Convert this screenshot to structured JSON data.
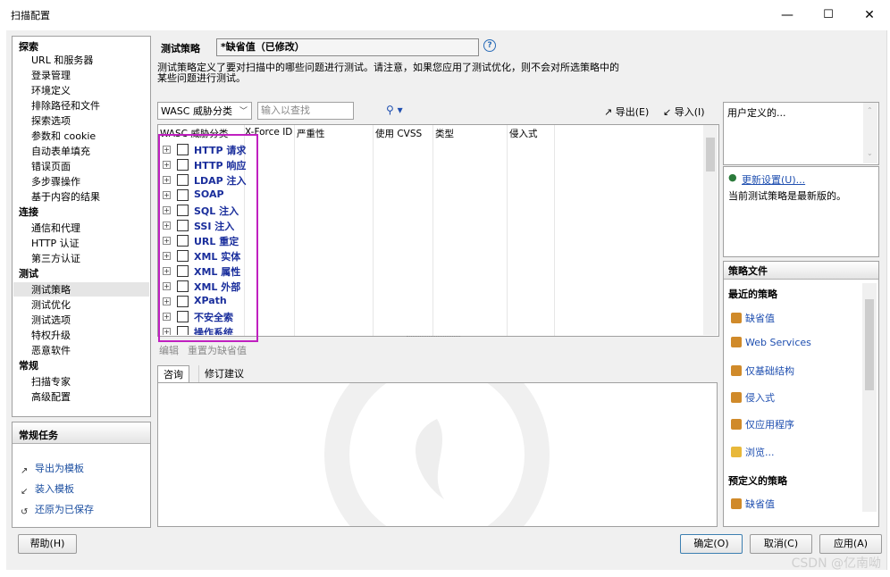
{
  "window": {
    "title": "扫描配置",
    "min_glyph": "—",
    "max_glyph": "☐",
    "close_glyph": "✕"
  },
  "nav": {
    "groups": [
      {
        "label": "探索",
        "items": [
          "URL 和服务器",
          "登录管理",
          "环境定义",
          "排除路径和文件",
          "探索选项",
          "参数和 cookie",
          "自动表单填充",
          "错误页面",
          "多步骤操作",
          "基于内容的结果"
        ]
      },
      {
        "label": "连接",
        "items": [
          "通信和代理",
          "HTTP 认证",
          "第三方认证"
        ]
      },
      {
        "label": "测试",
        "items": [
          "测试策略",
          "测试优化",
          "测试选项",
          "特权升级",
          "恶意软件"
        ]
      },
      {
        "label": "常规",
        "items": [
          "扫描专家",
          "高级配置"
        ]
      }
    ],
    "selected": "测试策略"
  },
  "tasks": {
    "title": "常规任务",
    "items": [
      {
        "label": "导出为模板",
        "icon": "export-icon"
      },
      {
        "label": "装入模板",
        "icon": "import-icon"
      },
      {
        "label": "还原为已保存",
        "icon": "restore-icon"
      }
    ]
  },
  "policy": {
    "label": "测试策略",
    "value": "*缺省值（已修改）",
    "description_line1": "测试策略定义了要对扫描中的哪些问题进行测试。请注意，如果您应用了测试优化，则不会对所选策略中的",
    "description_line2": "某些问题进行测试。"
  },
  "toolbar": {
    "group_by": "WASC 威胁分类",
    "search_placeholder": "输入以查找",
    "export_label": "导出(E)",
    "import_label": "导入(I)"
  },
  "grid": {
    "headers": [
      "WASC 威胁分类",
      "X-Force ID",
      "严重性",
      "使用 CVSS",
      "类型",
      "侵入式"
    ],
    "rows": [
      "HTTP 请求",
      "HTTP 响应",
      "LDAP 注入",
      "SOAP",
      "SQL 注入",
      "SSI 注入",
      "URL 重定",
      "XML 实体",
      "XML 属性",
      "XML 外部",
      "XPath",
      "不安全索",
      "操作系统"
    ],
    "edit_label": "编辑",
    "reset_label": "重置为缺省值"
  },
  "tabs": [
    "咨询",
    "修订建议"
  ],
  "right": {
    "user_defined": "用户定义的...",
    "update_link": "更新设置(U)...",
    "status": "当前测试策略是最新版的。",
    "policy_files_title": "策略文件",
    "recent_title": "最近的策略",
    "recent": [
      "缺省值",
      "Web Services",
      "仅基础结构",
      "侵入式",
      "仅应用程序"
    ],
    "browse": "浏览...",
    "predefined_title": "预定义的策略",
    "predefined": [
      "缺省值"
    ]
  },
  "footer": {
    "help": "帮助(H)",
    "ok": "确定(O)",
    "cancel": "取消(C)",
    "apply": "应用(A)"
  },
  "watermark": "CSDN @亿南呦"
}
